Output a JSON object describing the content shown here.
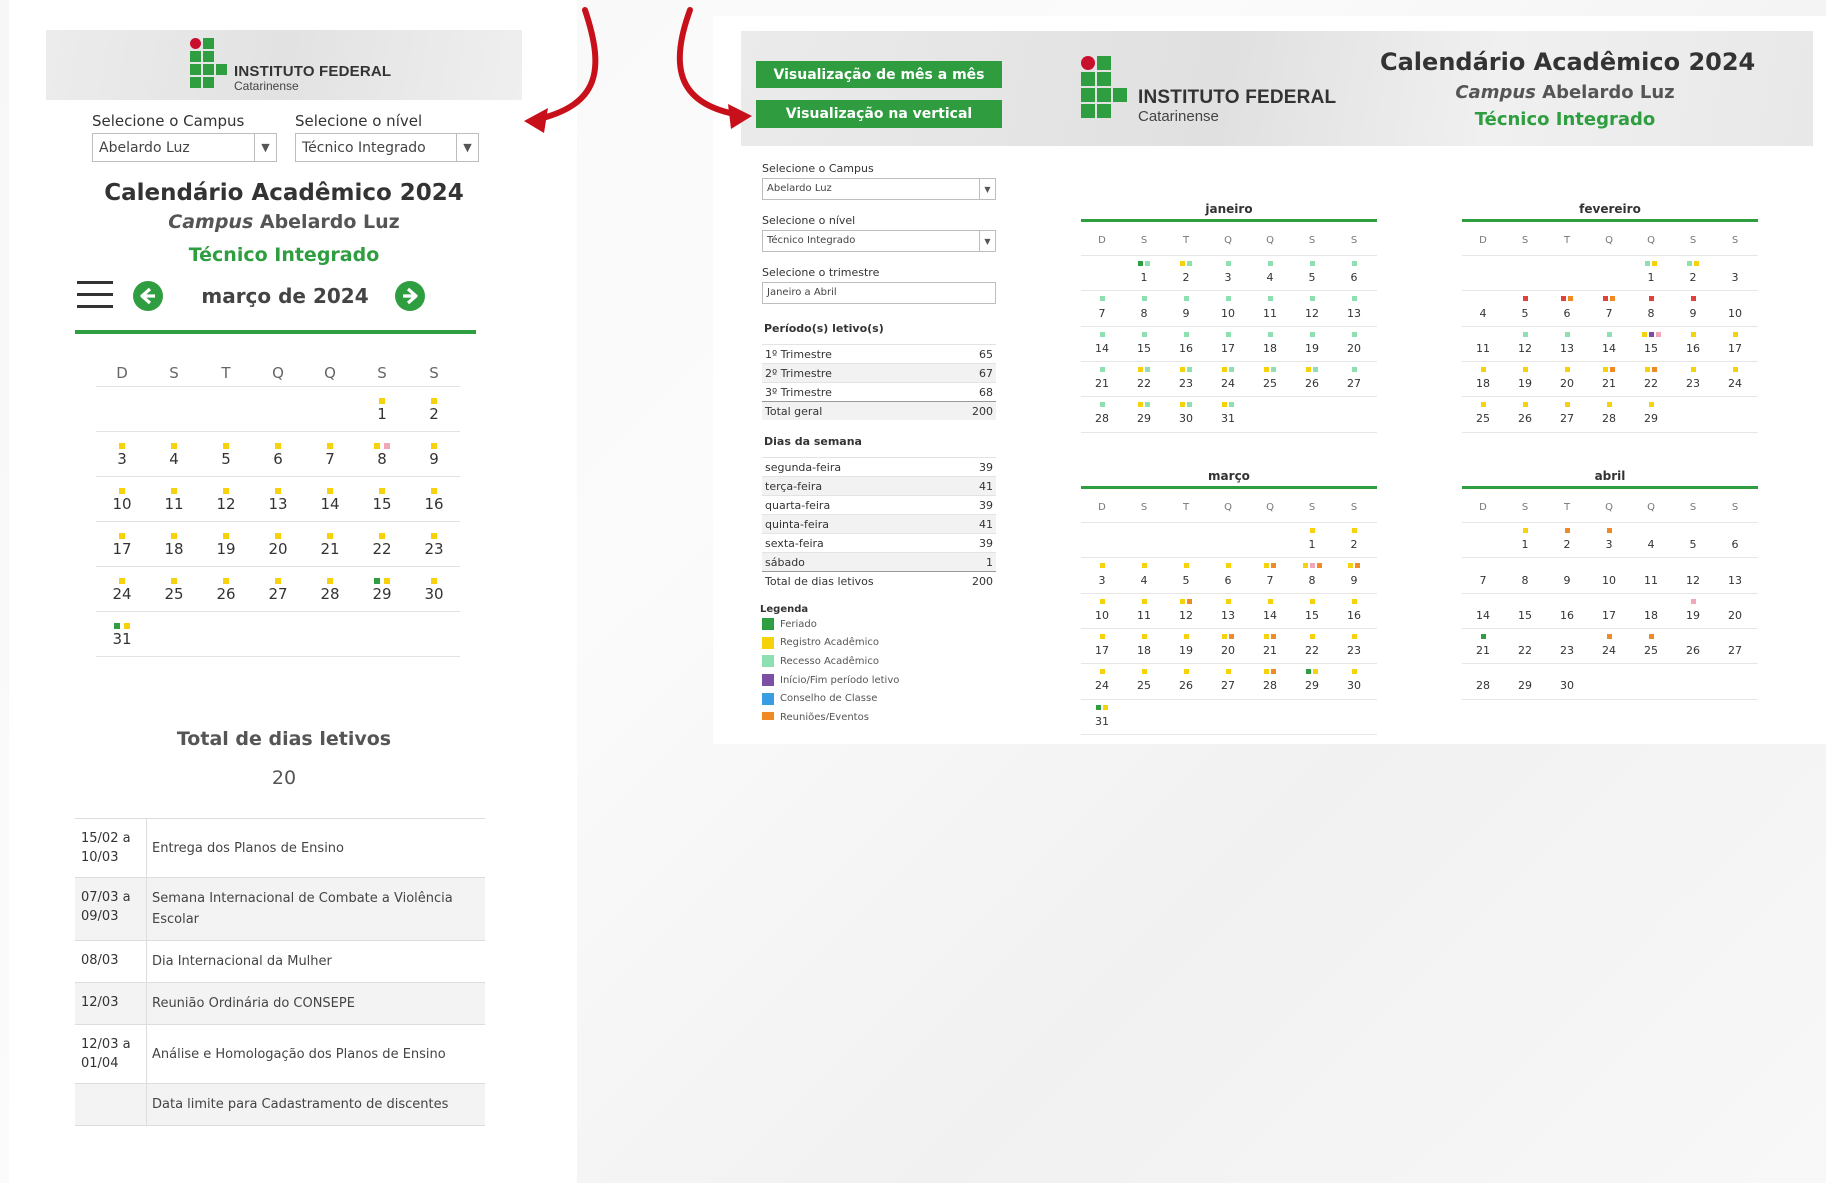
{
  "colors": {
    "feriado": "#2f9e41",
    "registro": "#f5d20a",
    "recesso": "#8fe0b0",
    "inicio_fim": "#7b4fa6",
    "conselho": "#3b9ce6",
    "reunioes": "#f08a24",
    "pink": "#f2a7b8",
    "red": "#e0413a",
    "brand_green": "#2f9e41",
    "arrow_red": "#c8101a"
  },
  "logo": {
    "line1": "INSTITUTO FEDERAL",
    "line2": "Catarinense"
  },
  "mobile": {
    "campus_label": "Selecione o Campus",
    "campus_value": "Abelardo Luz",
    "level_label": "Selecione o nível",
    "level_value": "Técnico Integrado",
    "title": "Calendário Acadêmico 2024",
    "subtitle_italic": "Campus",
    "subtitle_rest": " Abelardo Luz",
    "level_text": "Técnico Integrado",
    "prev_icon": "arrow-left-icon",
    "next_icon": "arrow-right-icon",
    "month_title": "março de 2024",
    "weekday_headers": [
      "D",
      "S",
      "T",
      "Q",
      "Q",
      "S",
      "S"
    ],
    "first_weekday": 5,
    "days": [
      {
        "d": 1,
        "dots": [
          "registro"
        ]
      },
      {
        "d": 2,
        "dots": [
          "registro"
        ]
      },
      {
        "d": 3,
        "dots": [
          "registro"
        ]
      },
      {
        "d": 4,
        "dots": [
          "registro"
        ]
      },
      {
        "d": 5,
        "dots": [
          "registro"
        ]
      },
      {
        "d": 6,
        "dots": [
          "registro"
        ]
      },
      {
        "d": 7,
        "dots": [
          "registro"
        ]
      },
      {
        "d": 8,
        "dots": [
          "registro",
          "pink"
        ]
      },
      {
        "d": 9,
        "dots": [
          "registro"
        ]
      },
      {
        "d": 10,
        "dots": [
          "registro"
        ]
      },
      {
        "d": 11,
        "dots": [
          "registro"
        ]
      },
      {
        "d": 12,
        "dots": [
          "registro"
        ]
      },
      {
        "d": 13,
        "dots": [
          "registro"
        ]
      },
      {
        "d": 14,
        "dots": [
          "registro"
        ]
      },
      {
        "d": 15,
        "dots": [
          "registro"
        ]
      },
      {
        "d": 16,
        "dots": [
          "registro"
        ]
      },
      {
        "d": 17,
        "dots": [
          "registro"
        ]
      },
      {
        "d": 18,
        "dots": [
          "registro"
        ]
      },
      {
        "d": 19,
        "dots": [
          "registro"
        ]
      },
      {
        "d": 20,
        "dots": [
          "registro"
        ]
      },
      {
        "d": 21,
        "dots": [
          "registro"
        ]
      },
      {
        "d": 22,
        "dots": [
          "registro"
        ]
      },
      {
        "d": 23,
        "dots": [
          "registro"
        ]
      },
      {
        "d": 24,
        "dots": [
          "registro"
        ]
      },
      {
        "d": 25,
        "dots": [
          "registro"
        ]
      },
      {
        "d": 26,
        "dots": [
          "registro"
        ]
      },
      {
        "d": 27,
        "dots": [
          "registro"
        ]
      },
      {
        "d": 28,
        "dots": [
          "registro"
        ]
      },
      {
        "d": 29,
        "dots": [
          "feriado",
          "registro"
        ]
      },
      {
        "d": 30,
        "dots": [
          "registro"
        ]
      },
      {
        "d": 31,
        "dots": [
          "feriado",
          "registro"
        ]
      }
    ],
    "total_label": "Total de dias letivos",
    "total_value": "20",
    "events": [
      {
        "date": "15/02 a 10/03",
        "text": "Entrega dos Planos de Ensino"
      },
      {
        "date": "07/03 a 09/03",
        "text": "Semana Internacional de Combate a Violência Escolar"
      },
      {
        "date": "08/03",
        "text": "Dia Internacional da Mulher"
      },
      {
        "date": "12/03",
        "text": "Reunião Ordinária do CONSEPE"
      },
      {
        "date": "12/03 a 01/04",
        "text": "Análise e Homologação dos Planos de Ensino"
      },
      {
        "date": "",
        "text": "Data limite para Cadastramento de discentes"
      }
    ]
  },
  "desktop": {
    "btn_month": "Visualização de mês a mês",
    "btn_vertical": "Visualização na vertical",
    "title": "Calendário Acadêmico 2024",
    "subtitle_italic": "Campus",
    "subtitle_rest": " Abelardo Luz",
    "level_text": "Técnico Integrado",
    "campus_label": "Selecione o Campus",
    "campus_value": "Abelardo Luz",
    "level_label": "Selecione o nível",
    "level_value": "Técnico Integrado",
    "trimestre_label": "Selecione o trimestre",
    "trimestre_value": "Janeiro a Abril",
    "periodos_title": "Período(s) letivo(s)",
    "periodos": [
      {
        "name": "1º Trimestre",
        "value": "65"
      },
      {
        "name": "2º Trimestre",
        "value": "67"
      },
      {
        "name": "3º Trimestre",
        "value": "68"
      },
      {
        "name": "Total geral",
        "value": "200"
      }
    ],
    "dias_title": "Dias da semana",
    "dias": [
      {
        "name": "segunda-feira",
        "value": "39"
      },
      {
        "name": "terça-feira",
        "value": "41"
      },
      {
        "name": "quarta-feira",
        "value": "39"
      },
      {
        "name": "quinta-feira",
        "value": "41"
      },
      {
        "name": "sexta-feira",
        "value": "39"
      },
      {
        "name": "sábado",
        "value": "1"
      },
      {
        "name": "Total de dias letivos",
        "value": "200"
      }
    ],
    "legend_title": "Legenda",
    "legend": [
      {
        "key": "feriado",
        "label": "Feriado"
      },
      {
        "key": "registro",
        "label": "Registro Acadêmico"
      },
      {
        "key": "recesso",
        "label": "Recesso Acadêmico"
      },
      {
        "key": "inicio_fim",
        "label": "Início/Fim período letivo"
      },
      {
        "key": "conselho",
        "label": "Conselho de Classe"
      },
      {
        "key": "reunioes",
        "label": "Reuniões/Eventos"
      }
    ],
    "weekday_headers": [
      "D",
      "S",
      "T",
      "Q",
      "Q",
      "S",
      "S"
    ],
    "months": [
      {
        "name": "janeiro",
        "first_weekday": 1,
        "length": 31,
        "dots": {
          "1": [
            "feriado",
            "recesso"
          ],
          "2": [
            "registro",
            "recesso"
          ],
          "3": [
            "recesso"
          ],
          "4": [
            "recesso"
          ],
          "5": [
            "recesso"
          ],
          "6": [
            "recesso"
          ],
          "7": [
            "recesso"
          ],
          "8": [
            "recesso"
          ],
          "9": [
            "recesso"
          ],
          "10": [
            "recesso"
          ],
          "11": [
            "recesso"
          ],
          "12": [
            "recesso"
          ],
          "13": [
            "recesso"
          ],
          "14": [
            "recesso"
          ],
          "15": [
            "recesso"
          ],
          "16": [
            "recesso"
          ],
          "17": [
            "recesso"
          ],
          "18": [
            "recesso"
          ],
          "19": [
            "recesso"
          ],
          "20": [
            "recesso"
          ],
          "21": [
            "recesso"
          ],
          "22": [
            "registro",
            "recesso"
          ],
          "23": [
            "registro",
            "recesso"
          ],
          "24": [
            "registro",
            "recesso"
          ],
          "25": [
            "registro",
            "recesso"
          ],
          "26": [
            "registro",
            "recesso"
          ],
          "27": [
            "recesso"
          ],
          "28": [
            "recesso"
          ],
          "29": [
            "registro",
            "recesso"
          ],
          "30": [
            "registro",
            "recesso"
          ],
          "31": [
            "registro",
            "recesso"
          ]
        }
      },
      {
        "name": "fevereiro",
        "first_weekday": 4,
        "length": 29,
        "dots": {
          "1": [
            "recesso",
            "registro"
          ],
          "2": [
            "recesso",
            "registro"
          ],
          "3": [],
          "4": [],
          "5": [
            "red"
          ],
          "6": [
            "red",
            "reunioes"
          ],
          "7": [
            "red",
            "reunioes"
          ],
          "8": [
            "red"
          ],
          "9": [
            "red"
          ],
          "10": [],
          "11": [],
          "12": [
            "recesso"
          ],
          "13": [
            "recesso"
          ],
          "14": [
            "recesso"
          ],
          "15": [
            "registro",
            "inicio_fim",
            "pink"
          ],
          "16": [
            "registro"
          ],
          "17": [
            "registro"
          ],
          "18": [
            "registro"
          ],
          "19": [
            "registro"
          ],
          "20": [
            "registro"
          ],
          "21": [
            "registro",
            "reunioes"
          ],
          "22": [
            "registro",
            "reunioes"
          ],
          "23": [
            "registro"
          ],
          "24": [
            "registro"
          ],
          "25": [
            "registro"
          ],
          "26": [
            "registro"
          ],
          "27": [
            "registro"
          ],
          "28": [
            "registro"
          ],
          "29": [
            "registro"
          ]
        }
      },
      {
        "name": "março",
        "first_weekday": 5,
        "length": 31,
        "dots": {
          "1": [
            "registro"
          ],
          "2": [
            "registro"
          ],
          "3": [
            "registro"
          ],
          "4": [
            "registro"
          ],
          "5": [
            "registro"
          ],
          "6": [
            "registro"
          ],
          "7": [
            "registro",
            "reunioes"
          ],
          "8": [
            "registro",
            "pink",
            "reunioes"
          ],
          "9": [
            "registro",
            "reunioes"
          ],
          "10": [
            "registro"
          ],
          "11": [
            "registro"
          ],
          "12": [
            "registro",
            "reunioes"
          ],
          "13": [
            "registro"
          ],
          "14": [
            "registro"
          ],
          "15": [
            "registro"
          ],
          "16": [
            "registro"
          ],
          "17": [
            "registro"
          ],
          "18": [
            "registro"
          ],
          "19": [
            "registro"
          ],
          "20": [
            "registro",
            "reunioes"
          ],
          "21": [
            "registro",
            "reunioes"
          ],
          "22": [
            "registro"
          ],
          "23": [
            "registro"
          ],
          "24": [
            "registro"
          ],
          "25": [
            "registro"
          ],
          "26": [
            "registro"
          ],
          "27": [
            "registro"
          ],
          "28": [
            "registro",
            "reunioes"
          ],
          "29": [
            "feriado",
            "registro"
          ],
          "30": [
            "registro"
          ],
          "31": [
            "feriado",
            "registro"
          ]
        }
      },
      {
        "name": "abril",
        "first_weekday": 1,
        "length": 30,
        "dots": {
          "1": [
            "registro"
          ],
          "2": [
            "reunioes"
          ],
          "3": [
            "reunioes"
          ],
          "4": [],
          "5": [],
          "6": [],
          "7": [],
          "8": [],
          "9": [],
          "10": [],
          "11": [],
          "12": [],
          "13": [],
          "14": [],
          "15": [],
          "16": [],
          "17": [],
          "18": [],
          "19": [
            "pink"
          ],
          "20": [],
          "21": [
            "feriado"
          ],
          "22": [],
          "23": [],
          "24": [
            "reunioes"
          ],
          "25": [
            "reunioes"
          ],
          "26": [],
          "27": [],
          "28": [],
          "29": [],
          "30": []
        }
      }
    ]
  }
}
